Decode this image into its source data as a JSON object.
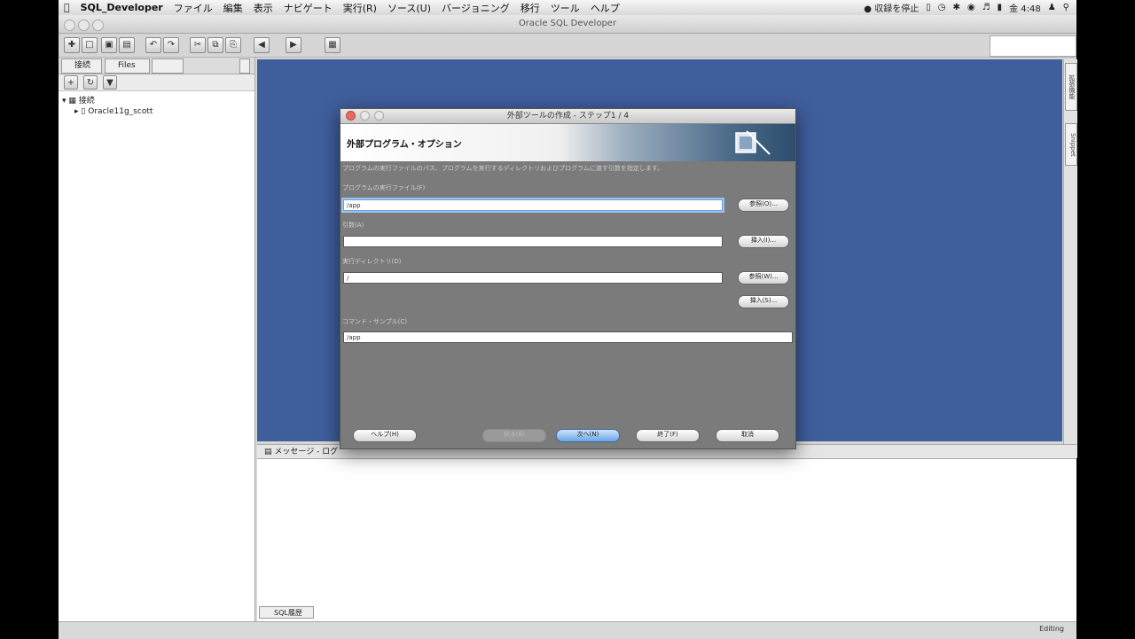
{
  "menubar": {
    "apple": "",
    "app_name": "SQL_Developer",
    "items": [
      "ファイル",
      "編集",
      "表示",
      "ナビゲート",
      "実行(R)",
      "ソース(U)",
      "バージョニング",
      "移行",
      "ツール",
      "ヘルプ"
    ],
    "status_text": "収録を停止",
    "clock": "金 4:48"
  },
  "window": {
    "title": "Oracle SQL Developer"
  },
  "left_panel": {
    "tabs": [
      "接続",
      "Files",
      ""
    ],
    "tree_root": "接続",
    "tree_child": "Oracle11g_scott"
  },
  "right_sidebar": {
    "tabs": [
      "拡張機能",
      "Snippet"
    ]
  },
  "messages": {
    "title": "メッセージ - ログ",
    "bottom_tab": "SQL履歴"
  },
  "statusbar": {
    "mode": "Editing"
  },
  "dialog": {
    "title": "外部ツールの作成 - ステップ1 / 4",
    "header": "外部プログラム・オプション",
    "description": "プログラムの実行ファイルのパス、プログラムを実行するディレクトリおよびプログラムに渡す引数を指定します。",
    "executable_label": "プログラムの実行ファイル(F)",
    "executable_value": "/app",
    "args_label": "引数(A)",
    "args_value": "",
    "workdir_label": "実行ディレクトリ(D)",
    "workdir_value": "/",
    "preview_label": "コマンド・サンプル(C)",
    "preview_value": "/app",
    "browse1": "参照(O)...",
    "insert1": "挿入(I)...",
    "browse2": "参照(W)...",
    "insert2": "挿入(S)...",
    "help": "ヘルプ(H)",
    "back": "戻る(B)",
    "next": "次へ(N)",
    "finish": "終了(F)",
    "cancel": "取消"
  }
}
